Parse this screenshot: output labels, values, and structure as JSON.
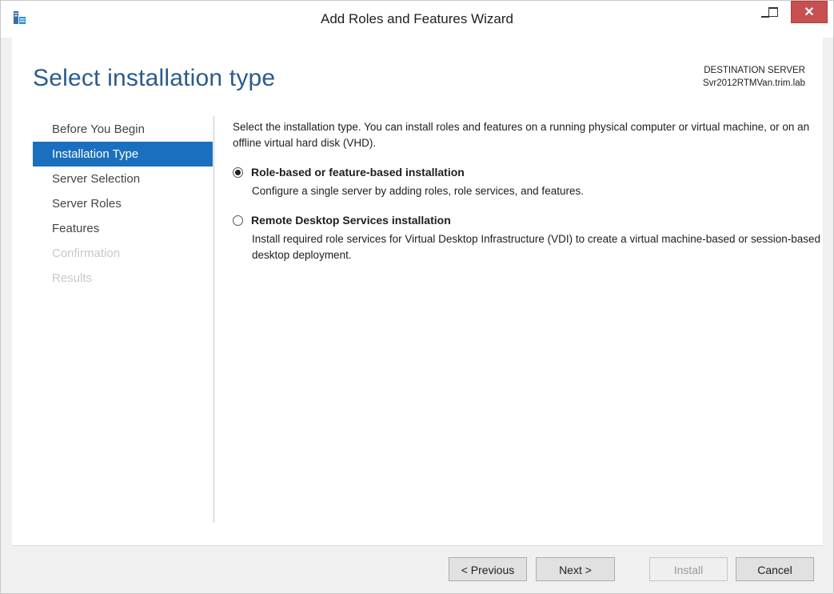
{
  "window": {
    "title": "Add Roles and Features Wizard",
    "close_glyph": "✕"
  },
  "header": {
    "page_title": "Select installation type",
    "destination_label": "DESTINATION SERVER",
    "destination_server": "Svr2012RTMVan.trim.lab"
  },
  "nav": {
    "items": [
      {
        "label": "Before You Begin",
        "state": "normal"
      },
      {
        "label": "Installation Type",
        "state": "active"
      },
      {
        "label": "Server Selection",
        "state": "normal"
      },
      {
        "label": "Server Roles",
        "state": "normal"
      },
      {
        "label": "Features",
        "state": "normal"
      },
      {
        "label": "Confirmation",
        "state": "disabled"
      },
      {
        "label": "Results",
        "state": "disabled"
      }
    ]
  },
  "main": {
    "description": "Select the installation type. You can install roles and features on a running physical computer or virtual machine, or on an offline virtual hard disk (VHD).",
    "options": [
      {
        "label": "Role-based or feature-based installation",
        "description": "Configure a single server by adding roles, role services, and features.",
        "selected": true
      },
      {
        "label": "Remote Desktop Services installation",
        "description": "Install required role services for Virtual Desktop Infrastructure (VDI) to create a virtual machine-based or session-based desktop deployment.",
        "selected": false
      }
    ]
  },
  "footer": {
    "previous_label": "< Previous",
    "next_label": "Next >",
    "install_label": "Install",
    "cancel_label": "Cancel"
  },
  "colors": {
    "accent": "#1a6fbf",
    "title": "#2a5b8f",
    "close": "#c75050"
  }
}
